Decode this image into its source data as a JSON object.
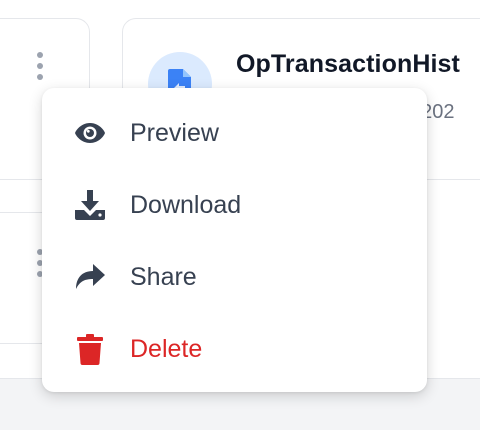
{
  "card": {
    "file_name": "OpTransactionHist",
    "file_meta": ", 202"
  },
  "menu": {
    "items": [
      {
        "label": "Preview",
        "icon": "eye-icon"
      },
      {
        "label": "Download",
        "icon": "download-icon"
      },
      {
        "label": "Share",
        "icon": "share-icon"
      },
      {
        "label": "Delete",
        "icon": "trash-icon"
      }
    ]
  },
  "colors": {
    "text": "#374151",
    "danger": "#dc2626",
    "icon_dark": "#374151",
    "file_badge_bg": "#dbeafe",
    "file_icon": "#3b82f6"
  }
}
